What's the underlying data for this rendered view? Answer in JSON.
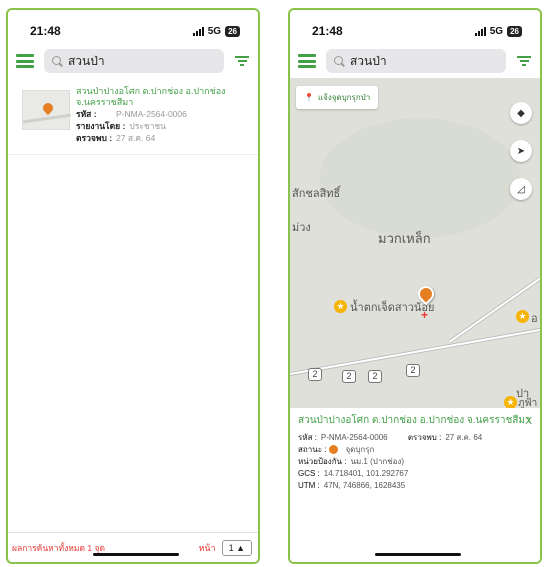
{
  "left": {
    "status": {
      "time": "21:48",
      "network": "5G",
      "battery": "26"
    },
    "search": {
      "value": "สวนป่า"
    },
    "result": {
      "title": "สวนป่าปางอโศก ต.ปากช่อง อ.ปากช่อง จ.นครราชสีมา",
      "code_label": "รหัส :",
      "code_value": "P-NMA-2564-0006",
      "reporter_label": "รายงานโดย :",
      "reporter_value": "ประชาชน",
      "detected_label": "ตรวจพบ :",
      "detected_value": "27 ส.ค. 64"
    },
    "footer": {
      "count_text": "ผลการค้นหาทั้งหมด 1 จุด",
      "page_label": "หน้า",
      "page_value": "1 ▲"
    }
  },
  "right": {
    "status": {
      "time": "21:48",
      "network": "5G",
      "battery": "26"
    },
    "search": {
      "value": "สวนป่า"
    },
    "map": {
      "report_button": "แจ้งจุดบุกรุกป่า",
      "place_labels": [
        "สักชลสิทธิ์",
        "ม่วง",
        "มวกเหล็ก",
        "น้ำตกเจ็ดสาวน้อย",
        "อ",
        "ปา",
        "ภูฟ้า"
      ],
      "route_numbers": [
        "2",
        "2",
        "2",
        "2"
      ]
    },
    "detail": {
      "title": "สวนป่าปางอโศก ต.ปากช่อง อ.ปากช่อง จ.นครราชสีมา",
      "close": "X",
      "code_label": "รหัส :",
      "code_value": "P-NMA-2564-0006",
      "detected_label": "ตรวจพบ :",
      "detected_value": "27 ส.ค. 64",
      "status_label": "สถานะ :",
      "status_value": "จุดบุกรุก",
      "unit_label": "หน่วยป้องกัน :",
      "unit_value": "นม.1 (ปากช่อง)",
      "gcs_label": "GCS :",
      "gcs_value": "14.718401, 101.292767",
      "utm_label": "UTM :",
      "utm_value": "47N, 746866, 1628435"
    }
  },
  "colors": {
    "accent": "#43a047",
    "border": "#8bc34a",
    "alert": "#e53935",
    "marker": "#e67e22"
  }
}
